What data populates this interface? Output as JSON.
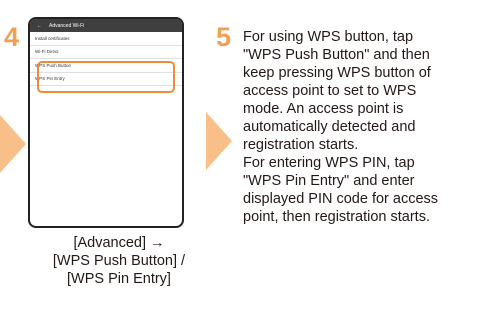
{
  "steps": [
    {
      "number": "4",
      "screen": {
        "back_icon": "back-arrow-icon",
        "back_glyph": "←",
        "title": "Advanced Wi-Fi",
        "items": [
          {
            "label": "Install certificates"
          },
          {
            "label": "Wi-Fi Direct"
          },
          {
            "label": "WPS Push Button"
          },
          {
            "label": "WPS Pin Entry"
          }
        ]
      },
      "caption": "[Advanced] →\n[WPS Push Button] /\n[WPS Pin Entry]"
    },
    {
      "number": "5",
      "description": "For using WPS button, tap\n\"WPS Push Button\" and then\nkeep pressing WPS button of\naccess point to set to WPS\nmode. An access point is\nautomatically detected and\nregistration starts.\nFor entering WPS PIN, tap\n\"WPS Pin Entry\" and enter\ndisplayed PIN code for access\npoint, then registration starts."
    }
  ],
  "colors": {
    "step_number": "#f0a050",
    "arrow": "#f8c088",
    "highlight": "#ee8a3b"
  }
}
